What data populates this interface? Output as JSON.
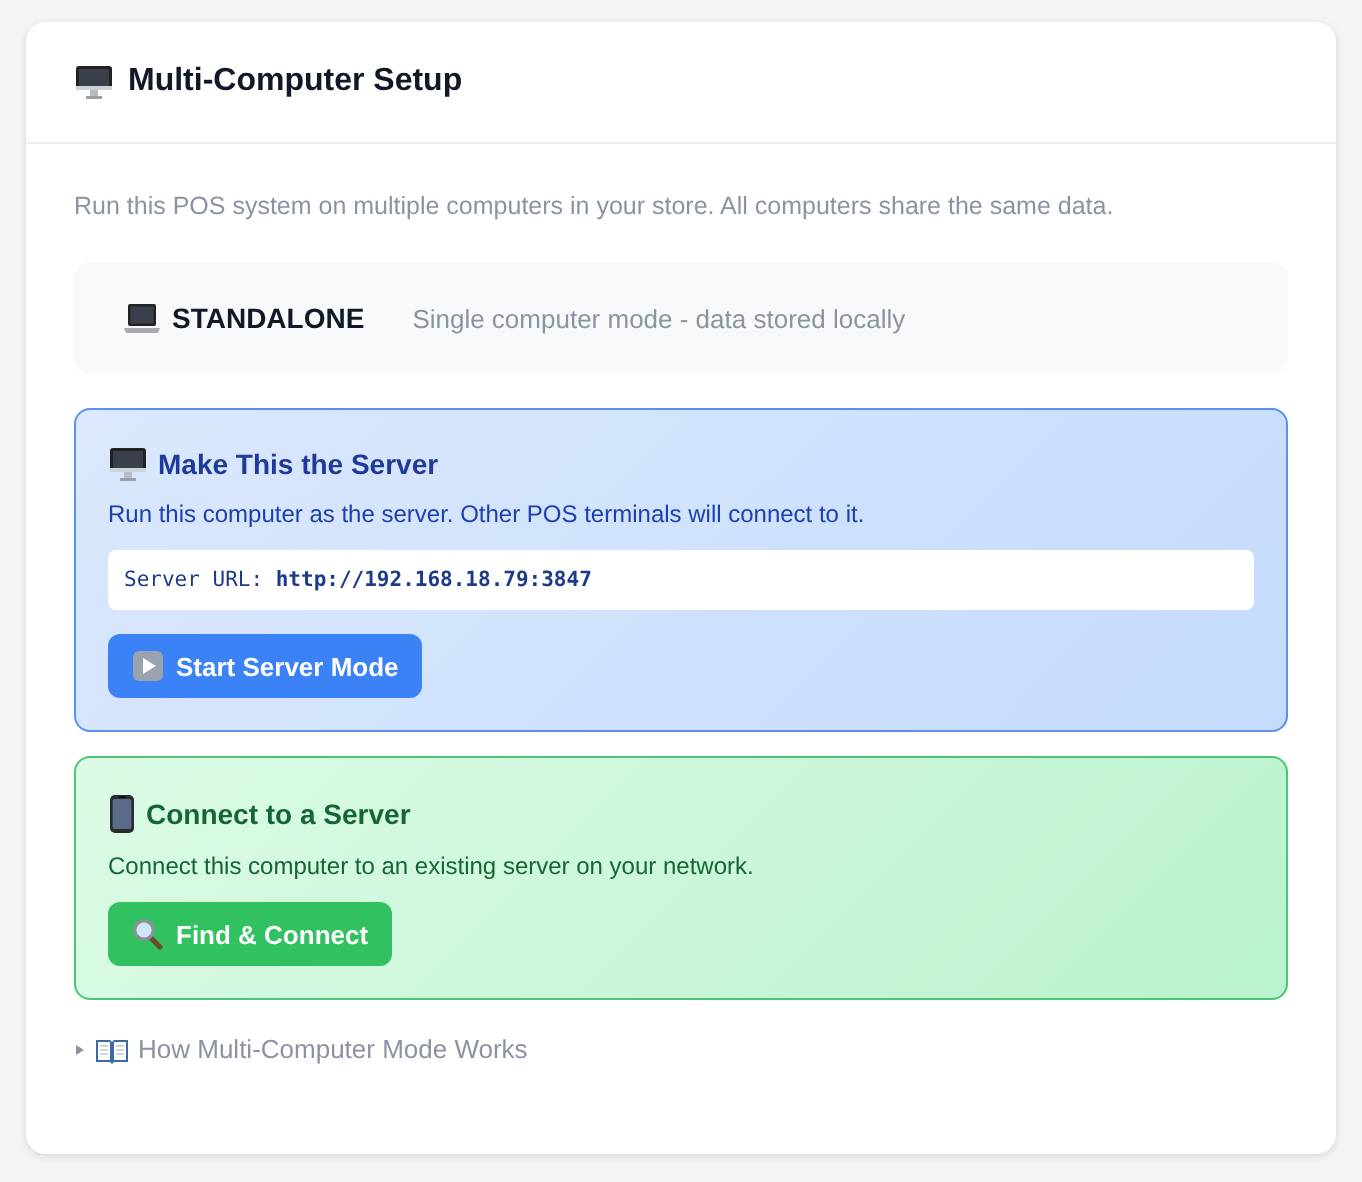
{
  "header": {
    "title": "Multi-Computer Setup"
  },
  "intro": "Run this POS system on multiple computers in your store. All computers share the same data.",
  "status": {
    "mode": "STANDALONE",
    "description": "Single computer mode - data stored locally"
  },
  "options": [
    {
      "kind": "server",
      "title": "Make This the Server",
      "description": "Run this computer as the server. Other POS terminals will connect to it.",
      "url": "Server URL: **http://192.168.18.79:3847**",
      "button": {
        "label": "Start Server Mode"
      }
    },
    {
      "kind": "client",
      "title": "Connect to a Server",
      "description": "Connect this computer to an existing server on your network.",
      "button": {
        "label": "Find & Connect"
      }
    }
  ],
  "help": {
    "expanded": false,
    "label": "How Multi-Computer Mode Works"
  }
}
